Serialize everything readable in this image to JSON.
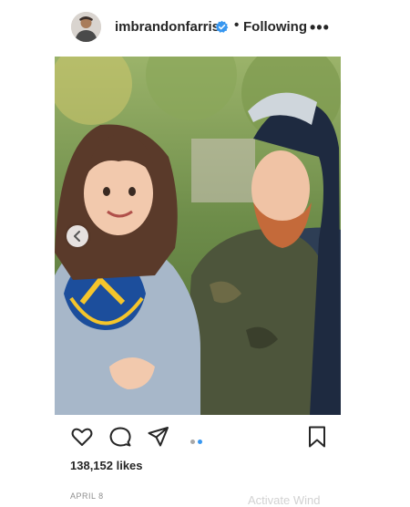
{
  "post": {
    "username": "imbrandonfarris",
    "separator": "•",
    "follow_status": "Following",
    "more_label": "•••",
    "likes": "138,152 likes",
    "date": "APRIL 8"
  },
  "carousel": {
    "slide_count": 2,
    "active_index": 1
  },
  "icons": {
    "verified": "verified-badge-icon",
    "like": "heart-icon",
    "comment": "comment-bubble-icon",
    "share": "paper-plane-icon",
    "save": "bookmark-icon",
    "prev": "chevron-left-icon"
  },
  "colors": {
    "verified_blue": "#3897f0",
    "pager_active": "#3897f0",
    "pager_inactive": "#a8a8a8",
    "text": "#262626",
    "muted": "#8e8e8e"
  },
  "watermark": {
    "text": "Activate Wind"
  }
}
